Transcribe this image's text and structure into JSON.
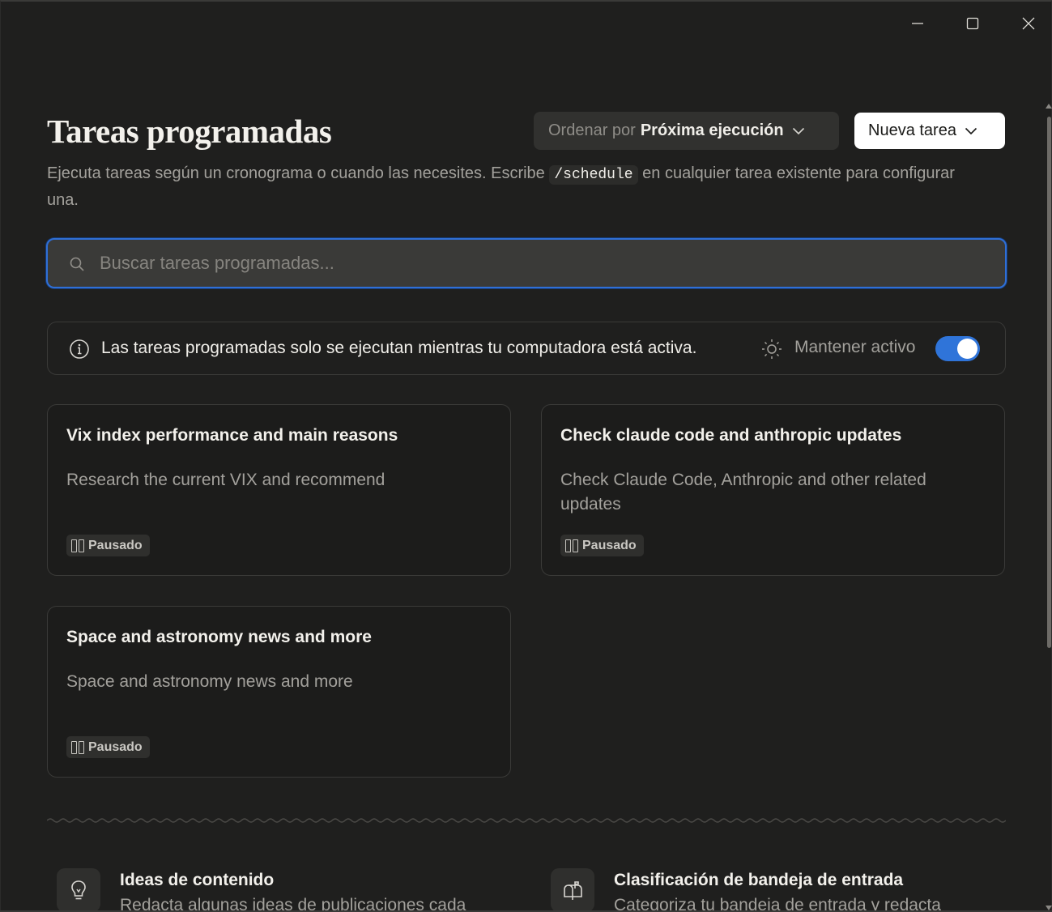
{
  "window": {
    "controls": [
      "minimize-icon",
      "maximize-icon",
      "close-icon"
    ]
  },
  "header": {
    "title": "Tareas programadas",
    "sort_prefix": "Ordenar por",
    "sort_value": "Próxima ejecución",
    "new_task_label": "Nueva tarea",
    "subtitle_before": "Ejecuta tareas según un cronograma o cuando las necesites. Escribe",
    "subtitle_code": "/schedule",
    "subtitle_after": "en cualquier tarea existente para configurar una."
  },
  "search": {
    "placeholder": "Buscar tareas programadas...",
    "value": ""
  },
  "info_bar": {
    "text": "Las tareas programadas solo se ejecutan mientras tu computadora está activa.",
    "keep_awake_label": "Mantener activo",
    "keep_awake_on": true
  },
  "tasks": [
    {
      "title": "Vix index performance and main reasons",
      "description": "Research the current VIX and recommend",
      "status": "Pausado"
    },
    {
      "title": "Check claude code and anthropic updates",
      "description": "Check Claude Code, Anthropic and other related updates",
      "status": "Pausado"
    },
    {
      "title": "Space and astronomy news and more",
      "description": "Space and astronomy news and more",
      "status": "Pausado"
    }
  ],
  "suggestions": [
    {
      "icon": "lightbulb-icon",
      "title": "Ideas de contenido",
      "description": "Redacta algunas ideas de publicaciones cada"
    },
    {
      "icon": "mailbox-icon",
      "title": "Clasificación de bandeja de entrada",
      "description": "Categoriza tu bandeja de entrada y redacta"
    }
  ],
  "colors": {
    "background": "#1f1f1e",
    "accent": "#2f74d9",
    "card_border": "#3a3a38"
  }
}
